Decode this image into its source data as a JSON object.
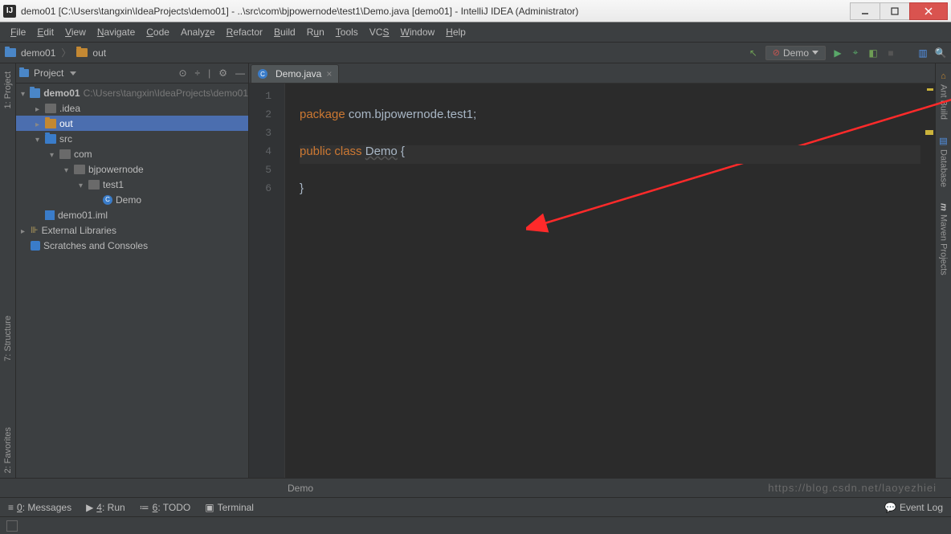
{
  "titlebar": {
    "text": "demo01 [C:\\Users\\tangxin\\IdeaProjects\\demo01] - ..\\src\\com\\bjpowernode\\test1\\Demo.java [demo01] - IntelliJ IDEA (Administrator)",
    "logo": "IJ"
  },
  "menu": {
    "file": "File",
    "edit": "Edit",
    "view": "View",
    "navigate": "Navigate",
    "code": "Code",
    "analyze": "Analyze",
    "refactor": "Refactor",
    "build": "Build",
    "run": "Run",
    "tools": "Tools",
    "vcs": "VCS",
    "window": "Window",
    "help": "Help"
  },
  "nav": {
    "root": "demo01",
    "out": "out"
  },
  "run_config": {
    "name": "Demo"
  },
  "left_tabs": {
    "project": "1: Project",
    "structure": "7: Structure",
    "favorites": "2: Favorites"
  },
  "right_tabs": {
    "ant": "Ant Build",
    "database": "Database",
    "maven": "Maven Projects"
  },
  "panel": {
    "title": "Project"
  },
  "tree": {
    "root": {
      "name": "demo01",
      "path": "C:\\Users\\tangxin\\IdeaProjects\\demo01"
    },
    "idea": ".idea",
    "out": "out",
    "src": "src",
    "com": "com",
    "bjpowernode": "bjpowernode",
    "test1": "test1",
    "demo": "Demo",
    "iml": "demo01.iml",
    "ext": "External Libraries",
    "scratch": "Scratches and Consoles"
  },
  "tab": {
    "name": "Demo.java"
  },
  "gutter": [
    "1",
    "2",
    "3",
    "4",
    "5",
    "6"
  ],
  "code": {
    "pkg_kw": "package",
    "pkg_val": " com.bjpowernode.test1;",
    "pub_kw": "public",
    "class_kw": "class",
    "cls": "Demo",
    "brace_o": " {",
    "brace_c": "}"
  },
  "breadcrumb": {
    "text": "Demo"
  },
  "toolwin": {
    "messages": "0: Messages",
    "run": "4: Run",
    "todo": "6: TODO",
    "terminal": "Terminal",
    "eventlog": "Event Log"
  },
  "watermark": "https://blog.csdn.net/laoyezhiei"
}
